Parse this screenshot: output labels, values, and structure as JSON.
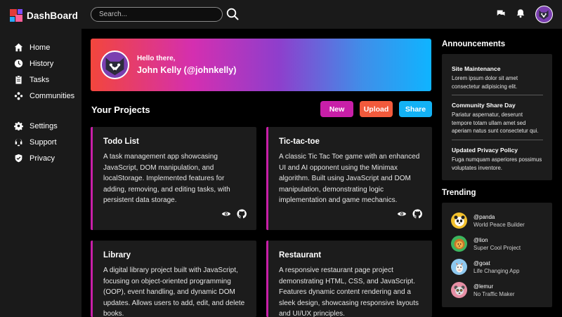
{
  "app": {
    "title": "DashBoard"
  },
  "sidebar": {
    "items": [
      {
        "label": "Home",
        "icon": "home-icon"
      },
      {
        "label": "History",
        "icon": "history-icon"
      },
      {
        "label": "Tasks",
        "icon": "tasks-icon"
      },
      {
        "label": "Communities",
        "icon": "communities-icon"
      }
    ],
    "bottom_items": [
      {
        "label": "Settings",
        "icon": "gear-icon"
      },
      {
        "label": "Support",
        "icon": "support-icon"
      },
      {
        "label": "Privacy",
        "icon": "shield-icon"
      }
    ]
  },
  "header": {
    "search": {
      "placeholder": "Search..."
    }
  },
  "welcome": {
    "greeting": "Hello there,",
    "name": "John Kelly (@johnkelly)"
  },
  "projects": {
    "title": "Your Projects",
    "buttons": {
      "new": "New",
      "upload": "Upload",
      "share": "Share"
    },
    "cards": [
      {
        "title": "Todo List",
        "description": "A task management app showcasing JavaScript, DOM manipulation, and localStorage. Implemented features for adding, removing, and editing tasks, with persistent data storage."
      },
      {
        "title": "Tic-tac-toe",
        "description": "A classic Tic Tac Toe game with an enhanced UI and AI opponent using the Minimax algorithm. Built using JavaScript and DOM manipulation, demonstrating logic implementation and game mechanics."
      },
      {
        "title": "Library",
        "description": "A digital library project built with JavaScript, focusing on object-oriented programming (OOP), event handling, and dynamic DOM updates. Allows users to add, edit, and delete books."
      },
      {
        "title": "Restaurant",
        "description": "A responsive restaurant page project demonstrating HTML, CSS, and JavaScript. Features dynamic content rendering and a sleek design, showcasing responsive layouts and UI/UX principles."
      }
    ]
  },
  "announcements": {
    "title": "Announcements",
    "items": [
      {
        "title": "Site Maintenance",
        "body": "Lorem ipsum dolor sit amet consectetur adipisicing elit."
      },
      {
        "title": "Community Share Day",
        "body": "Pariatur aspernatur, deserunt tempore totam ullam amet sed aperiam natus sunt consectetur qui."
      },
      {
        "title": "Updated Privacy Policy",
        "body": "Fuga numquam asperiores possimus voluptates inventore."
      }
    ]
  },
  "trending": {
    "title": "Trending",
    "items": [
      {
        "handle": "@panda",
        "project": "World Peace Builder"
      },
      {
        "handle": "@lion",
        "project": "Super Cool Project"
      },
      {
        "handle": "@goat",
        "project": "Life Changing App"
      },
      {
        "handle": "@lemur",
        "project": "No Traffic Maker"
      }
    ]
  },
  "colors": {
    "accent_magenta": "#c81fa8",
    "accent_orange": "#f25a3c",
    "accent_blue": "#13b2f5",
    "panel": "#1c1c1c",
    "background": "#000000"
  }
}
